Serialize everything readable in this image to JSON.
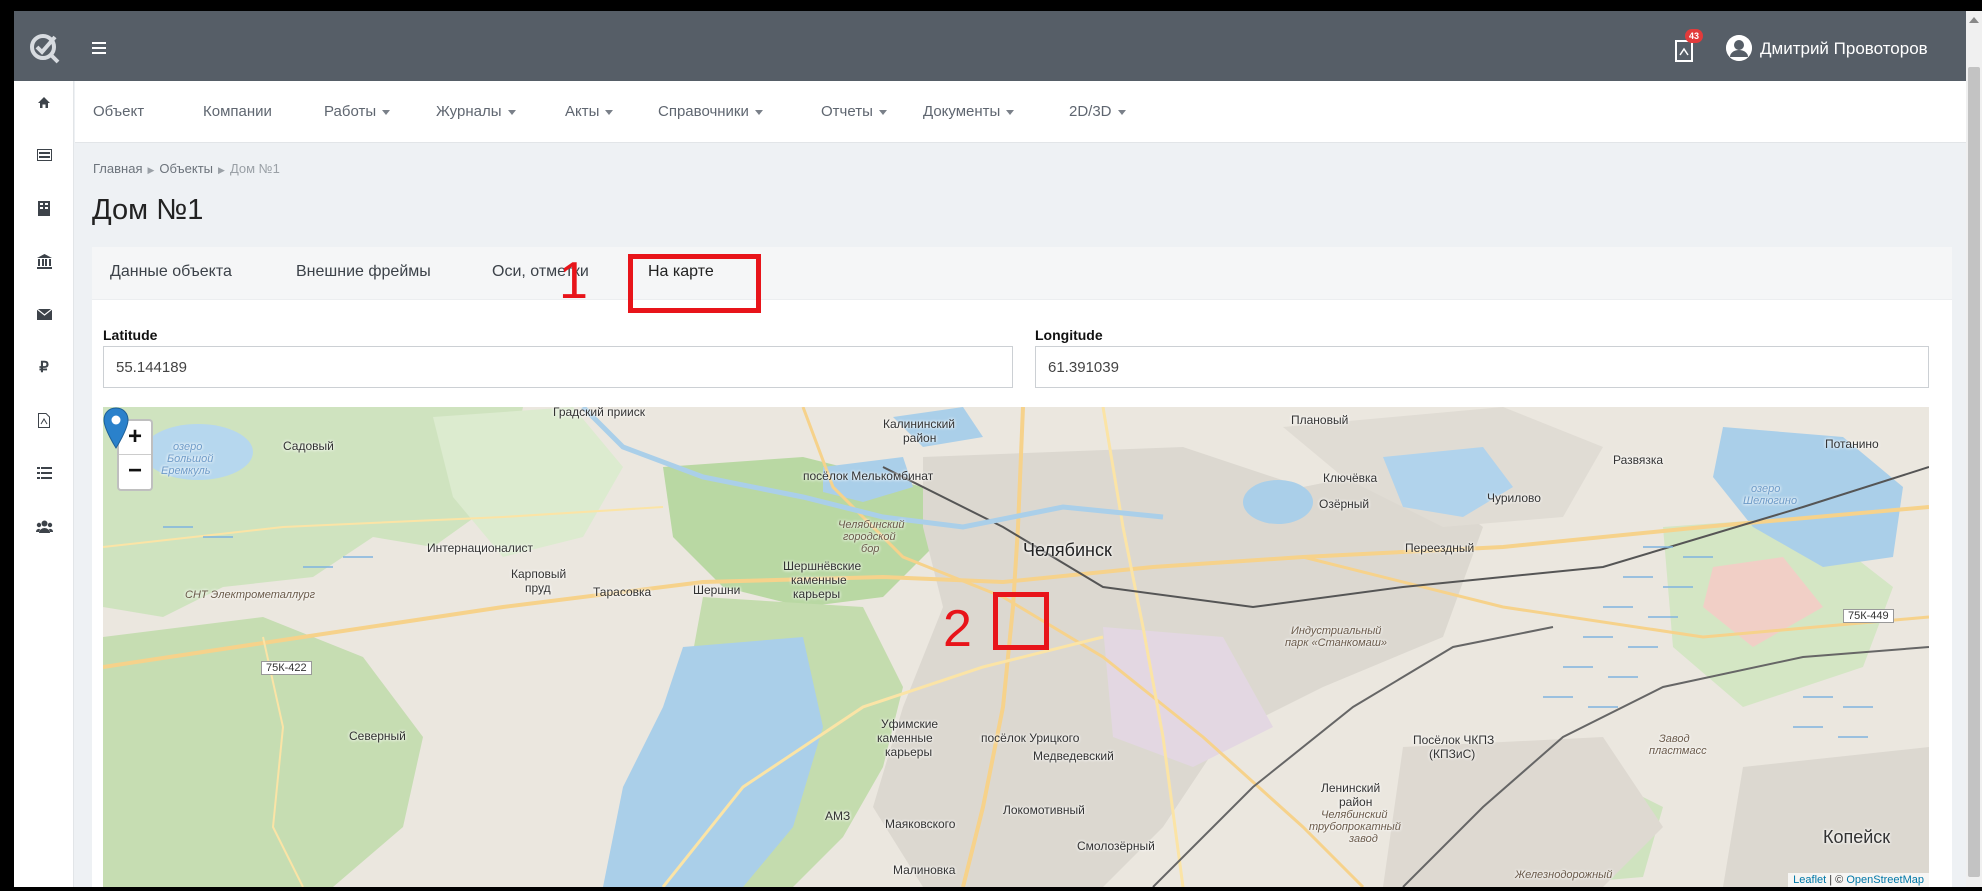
{
  "topbar": {
    "notification_count": "43",
    "user_name": "Дмитрий Провоторов"
  },
  "sidebar": {
    "items": [
      {
        "icon": "home-icon"
      },
      {
        "icon": "list-card-icon"
      },
      {
        "icon": "building-icon"
      },
      {
        "icon": "bank-icon"
      },
      {
        "icon": "envelope-icon"
      },
      {
        "icon": "ruble-icon"
      },
      {
        "icon": "pdf-file-icon"
      },
      {
        "icon": "list-icon"
      },
      {
        "icon": "users-icon"
      }
    ]
  },
  "menu": {
    "items": [
      {
        "label": "Объект",
        "dropdown": false
      },
      {
        "label": "Компании",
        "dropdown": false
      },
      {
        "label": "Работы",
        "dropdown": true
      },
      {
        "label": "Журналы",
        "dropdown": true
      },
      {
        "label": "Акты",
        "dropdown": true
      },
      {
        "label": "Справочники",
        "dropdown": true
      },
      {
        "label": "Отчеты",
        "dropdown": true
      },
      {
        "label": "Документы",
        "dropdown": true
      },
      {
        "label": "2D/3D",
        "dropdown": true
      }
    ]
  },
  "breadcrumb": {
    "items": [
      "Главная",
      "Объекты",
      "Дом №1"
    ]
  },
  "page": {
    "title": "Дом №1"
  },
  "tabs": [
    {
      "label": "Данные объекта"
    },
    {
      "label": "Внешние фреймы"
    },
    {
      "label": "Оси, отметки"
    },
    {
      "label": "На карте",
      "active": true
    }
  ],
  "annotations": {
    "one": "1",
    "two": "2"
  },
  "fields": {
    "latitude_label": "Latitude",
    "latitude_value": "55.144189",
    "longitude_label": "Longitude",
    "longitude_value": "61.391039"
  },
  "map": {
    "zoom_in": "+",
    "zoom_out": "−",
    "attribution_leaflet": "Leaflet",
    "attribution_sep": " | © ",
    "attribution_osm": "OpenStreetMap",
    "places": {
      "gradsky": "Градский прииск",
      "kalininsky": "Калининский",
      "kalininsky2": "район",
      "planovy": "Плановый",
      "potanino": "Потанино",
      "sadovy": "Садовый",
      "ozero_bolshoy": "озеро",
      "ozero_bolshoy2": "Большой",
      "ozero_bolshoy3": "Еремкуль",
      "melkombinat": "посёлок Мелькомбинат",
      "klyuchevka": "Ключёвка",
      "razvilka": "Развязка",
      "chelgorbor": "Челябинский",
      "chelgorbor2": "городской",
      "chelgorbor3": "бор",
      "ozerny": "Озёрный",
      "churilovo": "Чурилово",
      "ozero_shelyugino": "озеро",
      "ozero_shelyugino2": "Шелюгино",
      "internatsionalist": "Интернационалист",
      "chelyabinsk": "Челябинск",
      "pereezdny": "Переездный",
      "karpovy": "Карповый",
      "karpovy2": "пруд",
      "tarasovka": "Тарасовка",
      "shershni": "Шершни",
      "shersh_kar": "Шершнёвские",
      "shersh_kar2": "каменные",
      "shersh_kar3": "карьеры",
      "snt": "СНТ Электрометаллург",
      "ind_park": "Индустриальный",
      "ind_park2": "парк «Станкомаш»",
      "road_75k449": "75К-449",
      "road_75k422": "75К-422",
      "severny": "Северный",
      "ufa_kar": "Уфимские",
      "ufa_kar2": "каменные",
      "ufa_kar3": "карьеры",
      "uritsky": "посёлок Урицкого",
      "medvedevsky": "Медведевский",
      "chkpz": "Посёлок ЧКПЗ",
      "chkpz2": "(КПЗиС)",
      "zavod_plast": "Завод",
      "zavod_plast2": "пластмасс",
      "leninsky": "Ленинский",
      "leninsky2": "район",
      "chtpz": "Челябинский",
      "chtpz2": "трубопрокатный",
      "chtpz3": "завод",
      "amz": "АМЗ",
      "mayakovsky": "Маяковского",
      "lokomotivny": "Локомотивный",
      "kopeysk": "Копейск",
      "smolozerny": "Смолозёрный",
      "malinovka": "Малиновка",
      "zhelezno": "Железнодорожный"
    }
  },
  "colors": {
    "topbar": "#565e67",
    "highlight": "#e8141a",
    "marker": "#2a81cb",
    "forest": "#c4dfb0",
    "water": "#a9cde8"
  }
}
